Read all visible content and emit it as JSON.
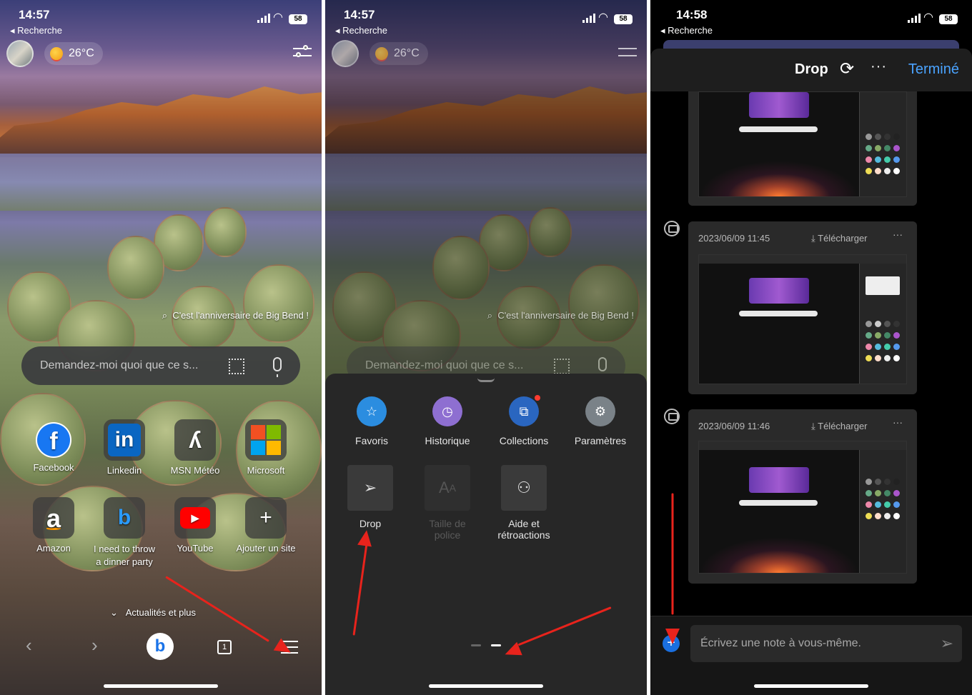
{
  "status": {
    "time_1": "14:57",
    "time_2": "14:57",
    "time_3": "14:58",
    "back_label": "◂ Recherche",
    "battery": "58"
  },
  "home": {
    "weather_temp": "26°C",
    "bing_caption": "C'est l'anniversaire de Big Bend !",
    "search_placeholder": "Demandez-moi quoi que ce s...",
    "tiles": [
      {
        "label": "Facebook",
        "icon": "facebook-icon",
        "color": "#1877f2"
      },
      {
        "label": "Linkedin",
        "icon": "linkedin-icon",
        "color": "#0a66c2"
      },
      {
        "label": "MSN Météo",
        "icon": "msn-weather-icon",
        "color": "#ffffff"
      },
      {
        "label": "Microsoft",
        "icon": "microsoft-icon",
        "color": "#f25022"
      },
      {
        "label": "Amazon",
        "icon": "amazon-icon",
        "color": "#ff9900"
      },
      {
        "label": "I need to throw a dinner party",
        "icon": "bing-icon",
        "color": "#2a9bff"
      },
      {
        "label": "YouTube",
        "icon": "youtube-icon",
        "color": "#ff0000"
      },
      {
        "label": "Ajouter un site",
        "icon": "plus-icon",
        "color": "#ffffff"
      }
    ],
    "news_label": "Actualités et plus",
    "tab_count": "1"
  },
  "menu": {
    "items": [
      {
        "label": "Favoris",
        "icon": "star-icon",
        "color": "#2b8de0"
      },
      {
        "label": "Historique",
        "icon": "history-icon",
        "color": "#8e6fd1"
      },
      {
        "label": "Collections",
        "icon": "collections-icon",
        "color": "#2a66c0"
      },
      {
        "label": "Paramètres",
        "icon": "gear-icon",
        "color": "#7a8288"
      }
    ],
    "tools": [
      {
        "label": "Drop",
        "icon": "send-icon",
        "enabled": true
      },
      {
        "label": "Taille de police",
        "icon": "font-size-icon",
        "enabled": false
      },
      {
        "label": "Aide et rétroactions",
        "icon": "feedback-icon",
        "enabled": true
      }
    ]
  },
  "drop": {
    "title": "Drop",
    "done_label": "Terminé",
    "download_label": "Télécharger",
    "messages": [
      {
        "date": "2023/06/09 11:45"
      },
      {
        "date": "2023/06/09 11:46"
      }
    ],
    "note_placeholder": "Écrivez une note à vous-même.",
    "accent_color": "#4aa3ff"
  },
  "annotation_color": "#e8231c"
}
